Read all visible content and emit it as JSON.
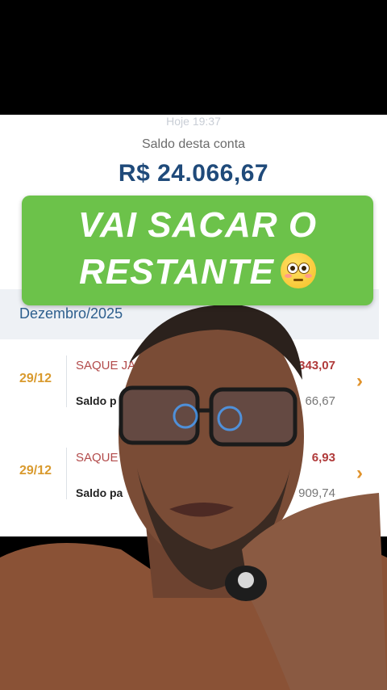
{
  "status": {
    "time": "Hoje 19:37"
  },
  "account": {
    "balance_label": "Saldo desta conta",
    "balance_value": "R$  24.066,67"
  },
  "caption": {
    "line1": "VAI SACAR O",
    "line2": "RESTANTE",
    "emoji": "flushed-face"
  },
  "statement": {
    "month": "Dezembro/2025",
    "rows": [
      {
        "date": "29/12",
        "desc": "SAQUE JA",
        "amount": "343,07",
        "saldo_label": "Saldo p",
        "saldo_value": "66,67"
      },
      {
        "date": "29/12",
        "desc": "SAQUE",
        "amount": "6,93",
        "saldo_label": "Saldo pa",
        "saldo_value": "909,74"
      }
    ]
  },
  "colors": {
    "accent_blue": "#1f4a7a",
    "caption_green": "#6cc24a",
    "date_orange": "#d99a2e",
    "amount_red": "#b03a3a"
  }
}
